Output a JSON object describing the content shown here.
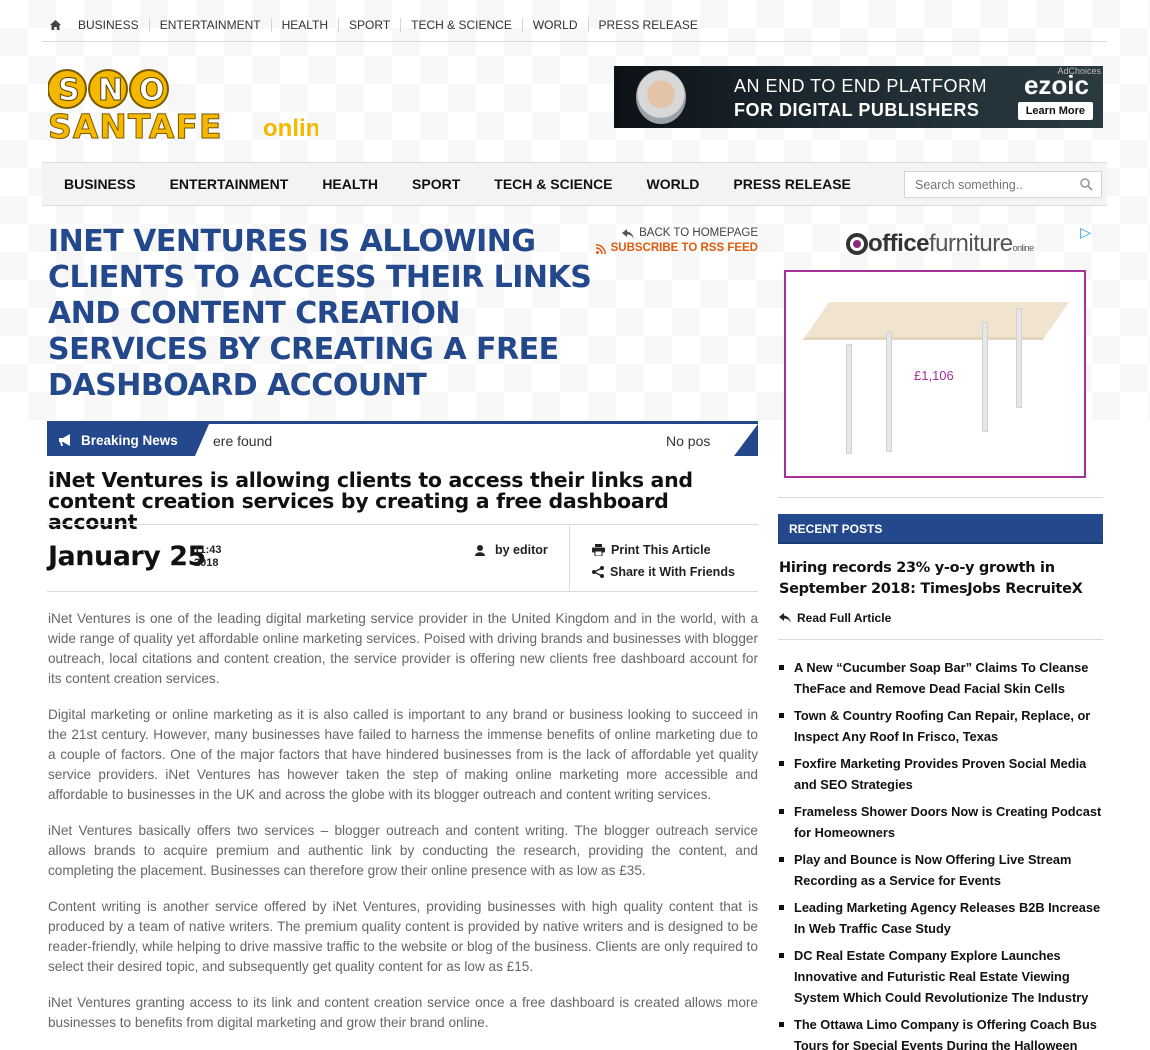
{
  "top_nav": {
    "items": [
      "BUSINESS",
      "ENTERTAINMENT",
      "HEALTH",
      "SPORT",
      "TECH & SCIENCE",
      "WORLD",
      "PRESS RELEASE"
    ]
  },
  "logo": {
    "line1": "SNO",
    "line2": "SANTAFE",
    "tag": "online"
  },
  "ad_banner": {
    "line1": "AN END TO END PLATFORM",
    "line2": "FOR DIGITAL PUBLISHERS",
    "brand": "ezoic",
    "cta": "Learn More",
    "adchoices": "AdChoices"
  },
  "main_nav": {
    "items": [
      "BUSINESS",
      "ENTERTAINMENT",
      "HEALTH",
      "SPORT",
      "TECH & SCIENCE",
      "WORLD",
      "PRESS RELEASE"
    ],
    "search_placeholder": "Search something.."
  },
  "article": {
    "title": "INET VENTURES IS ALLOWING CLIENTS TO ACCESS THEIR LINKS AND CONTENT CREATION SERVICES BY CREATING A FREE DASHBOARD ACCOUNT",
    "back_link": "BACK TO HOMEPAGE",
    "rss_link": "SUBSCRIBE TO RSS FEED",
    "breaking_label": "Breaking News",
    "breaking_text_1": "ere found",
    "breaking_text_2": "No pos",
    "subtitle": "iNet Ventures is allowing clients to access their links and content creation services by creating a free dashboard account",
    "date": "January 25",
    "time": "11:43",
    "year": "2018",
    "author": "by editor",
    "print": "Print This Article",
    "share": "Share it With Friends",
    "paragraphs": [
      "iNet Ventures is one of the leading digital marketing service provider in the United Kingdom and in the world, with a wide range of quality yet affordable online marketing services. Poised with driving brands and businesses with blogger outreach, local citations and content creation, the service provider is offering new clients free dashboard account for its content creation services.",
      "Digital marketing or online marketing as it is also called is important to any brand or business looking to succeed in the 21st century. However, many businesses have failed to harness the immense benefits of online marketing due to a couple of factors. One of the major factors that have hindered businesses from is the lack of affordable yet quality service providers. iNet Ventures has however taken the step of making online marketing more accessible and affordable to businesses in the UK and across the globe with its blogger outreach and content writing services.",
      "iNet Ventures basically offers two services – blogger outreach and content writing. The blogger outreach service allows brands to acquire premium and authentic link by conducting the research, providing the content, and completing the placement. Businesses can therefore grow their online presence with as low as £35.",
      "Content writing is another service offered by iNet Ventures, providing businesses with high quality content that is produced by a team of native writers. The premium quality content is provided by native writers and is designed to be reader-friendly, while helping to drive massive traffic to the website or blog of the business. Clients are only required to select their desired topic, and subsequently get quality content for as low as £15.",
      "iNet Ventures granting access to its link and content creation service once a free dashboard is created allows more businesses to benefits from digital marketing and grow their brand online."
    ]
  },
  "sidebar_ad": {
    "brand_a": "office",
    "brand_b": "furniture",
    "brand_c": "online",
    "price": "£1,106"
  },
  "recent_posts": {
    "heading": "RECENT POSTS",
    "featured_title": "Hiring records 23% y-o-y growth in September 2018: TimesJobs RecruiteX",
    "read_full": "Read Full Article",
    "items": [
      "A New “Cucumber Soap Bar” Claims To Cleanse TheFace and Remove Dead Facial Skin Cells",
      "Town & Country Roofing Can Repair, Replace, or Inspect Any Roof In Frisco, Texas",
      "Foxfire Marketing Provides Proven Social Media and SEO Strategies",
      "Frameless Shower Doors Now is Creating Podcast for Homeowners",
      "Play and Bounce is Now Offering Live Stream Recording as a Service for Events",
      "Leading Marketing Agency Releases B2B Increase In Web Traffic Case Study",
      "DC Real Estate Company Explore Launches Innovative and Futuristic Real Estate Viewing System Which Could Revolutionize The Industry",
      "The Ottawa Limo Company is Offering Coach Bus Tours for Special Events During the Halloween"
    ]
  },
  "colors": {
    "brand_blue": "#23488b",
    "rss_orange": "#e05a0c",
    "ad_purple": "#a3319a",
    "logo_yellow": "#f5b800"
  }
}
